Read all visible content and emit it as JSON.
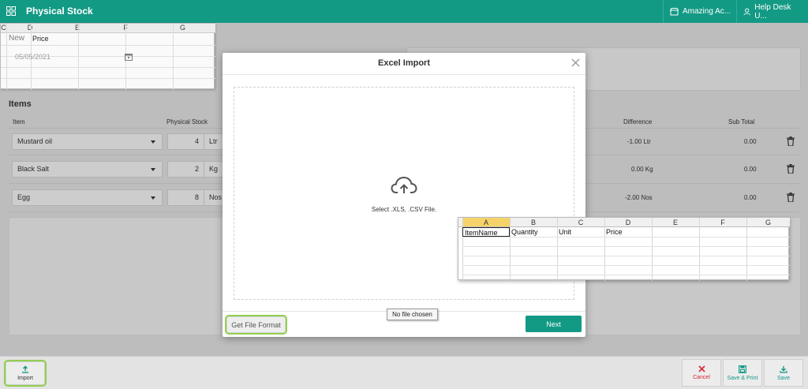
{
  "topbar": {
    "title": "Physical Stock",
    "company": "Amazing Ac...",
    "user": "Help Desk U..."
  },
  "form": {
    "new_label": "New",
    "date_value": "05/05/2021"
  },
  "items": {
    "title": "Items",
    "columns": {
      "item": "Item",
      "physical_stock": "Physical Stock",
      "difference": "Difference",
      "sub_total": "Sub Total"
    },
    "rows": [
      {
        "item": "Mustard oil",
        "qty": "4",
        "unit": "Ltr",
        "difference": "-1.00 Ltr",
        "sub_total": "0.00"
      },
      {
        "item": "Black Salt",
        "qty": "2",
        "unit": "Kg",
        "difference": "0.00 Kg",
        "sub_total": "0.00"
      },
      {
        "item": "Egg",
        "qty": "8",
        "unit": "Nos",
        "difference": "-2.00 Nos",
        "sub_total": "0.00"
      }
    ]
  },
  "sheet_top": {
    "columns": [
      "C",
      "D",
      "E",
      "F",
      "G"
    ],
    "cell_d1": "Price"
  },
  "modal": {
    "title": "Excel Import",
    "drop_text": "Select .XLS, .CSV File.",
    "get_file_format": "Get File Format",
    "next": "Next",
    "no_file": "No file chosen"
  },
  "sheet_modal": {
    "columns": [
      "A",
      "B",
      "C",
      "D",
      "E",
      "F",
      "G"
    ],
    "row1": [
      "ItemName",
      "Quantity",
      "Unit",
      "Price"
    ]
  },
  "bottombar": {
    "import": "Import",
    "cancel": "Cancel",
    "save_print": "Save & Print",
    "save": "Save"
  },
  "colors": {
    "primary": "#139a85",
    "highlight": "#92d050",
    "danger": "#d9262e"
  }
}
